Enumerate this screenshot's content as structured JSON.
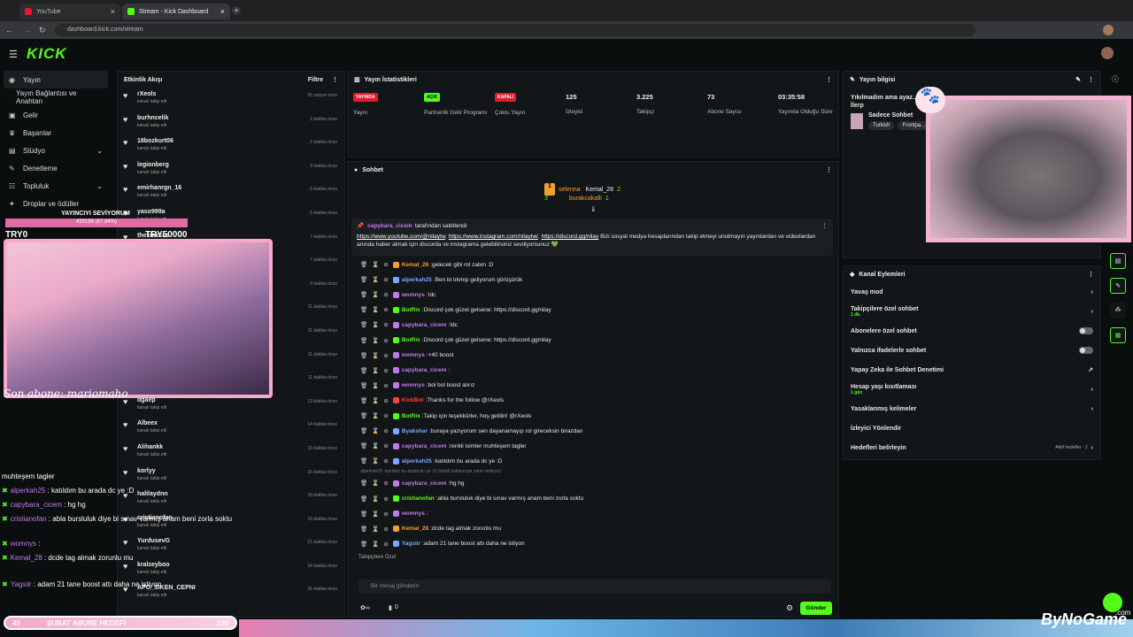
{
  "browser": {
    "tabs": [
      {
        "label": "YouTube"
      },
      {
        "label": "Stream - Kick Dashboard"
      }
    ],
    "url": "dashboard.kick.com/stream"
  },
  "brand": {
    "logo": "KICK",
    "accent": "#53fc18"
  },
  "nav": {
    "items": [
      {
        "label": "Yayın",
        "icon": "broadcast-icon"
      },
      {
        "label": "Yayın Bağlantısı ve Anahtarı",
        "icon": ""
      },
      {
        "label": "Gelir",
        "icon": "wallet-icon"
      },
      {
        "label": "Başarılar",
        "icon": "trophy-icon"
      },
      {
        "label": "Stüdyo",
        "icon": "studio-icon"
      },
      {
        "label": "Denetleme",
        "icon": "wrench-icon"
      },
      {
        "label": "Topluluk",
        "icon": "community-icon"
      },
      {
        "label": "Droplar ve ödüller",
        "icon": "gift-icon"
      }
    ]
  },
  "activity": {
    "title": "Etkinlik Akışı",
    "filter": "Filtre",
    "items": [
      {
        "name": "rXeols",
        "sub": "kanalı takip etti",
        "time": "36 saniye önce"
      },
      {
        "name": "burhncelik",
        "sub": "kanalı takip etti",
        "time": "2 dakika önce"
      },
      {
        "name": "18bozkurt06",
        "sub": "kanalı takip etti",
        "time": "2 dakika önce"
      },
      {
        "name": "legionberg",
        "sub": "kanalı takip etti",
        "time": "3 dakika önce"
      },
      {
        "name": "emirhanrgn_16",
        "sub": "kanalı takip etti",
        "time": "6 dakika önce"
      },
      {
        "name": "yaso999a",
        "sub": "kanalı takip etti",
        "time": "6 dakika önce"
      },
      {
        "name": "thexieksso",
        "sub": "kanalı takip etti",
        "time": "7 dakika önce"
      },
      {
        "name": "",
        "sub": "",
        "time": "7 dakika önce"
      },
      {
        "name": "",
        "sub": "",
        "time": "9 dakika önce"
      },
      {
        "name": "",
        "sub": "",
        "time": "11 dakika önce"
      },
      {
        "name": "",
        "sub": "",
        "time": "11 dakika önce"
      },
      {
        "name": "",
        "sub": "",
        "time": "11 dakika önce"
      },
      {
        "name": "",
        "sub": "",
        "time": "11 dakika önce"
      },
      {
        "name": "dgaep",
        "sub": "kanalı takip etti",
        "time": "13 dakika önce"
      },
      {
        "name": "Albeex",
        "sub": "kanalı takip etti",
        "time": "14 dakika önce"
      },
      {
        "name": "Alihankk",
        "sub": "kanalı takip etti",
        "time": "15 dakika önce"
      },
      {
        "name": "korlyy",
        "sub": "kanalı takip etti",
        "time": "16 dakika önce"
      },
      {
        "name": "halilaydnn",
        "sub": "kanalı takip etti",
        "time": "18 dakika önce"
      },
      {
        "name": "cristianofan",
        "sub": "kanalı takip etti",
        "time": "18 dakika önce"
      },
      {
        "name": "YurdusevG",
        "sub": "kanalı takip etti",
        "time": "21 dakika önce"
      },
      {
        "name": "kralzeyboo",
        "sub": "kanalı takip etti",
        "time": "24 dakika önce"
      },
      {
        "name": "APO_SIKEN_CEPNI",
        "sub": "kanalı takip etti",
        "time": "26 dakika önce"
      }
    ]
  },
  "stats": {
    "title": "Yayın İstatistikleri",
    "cells": [
      {
        "badge": "YAYINDA",
        "label": "Yayın",
        "color": "#e01b2b"
      },
      {
        "badge": "AÇIK",
        "label": "Partnerlik Gelir Programı",
        "color": "#53fc18"
      },
      {
        "badge": "KAPALI",
        "label": "Çoklu Yayın",
        "color": "#e01b2b"
      },
      {
        "value": "125",
        "label": "İzleyici"
      },
      {
        "value": "3.225",
        "label": "Takipçi"
      },
      {
        "value": "73",
        "label": "Abone Sayısı"
      },
      {
        "value": "03:35:58",
        "label": "Yayında Olduğu Süre"
      }
    ]
  },
  "chat": {
    "title": "Sohbet",
    "leaders": [
      {
        "rank": "1",
        "name": "selenna",
        "count": "3"
      },
      {
        "name": "Kemal_28",
        "count": "2"
      },
      {
        "name": "burakcakalli",
        "count": "1"
      }
    ],
    "pinned": {
      "by": "capybara_cicem",
      "by_suffix": "tarafından sabitlendi",
      "link1": "https://www.youtube.com/@nilaytw",
      "link2": "https://www.instagram.com/nilaytw/",
      "link3": "https://discord.gg/nilay",
      "text": "Bizi sosyal medya hesaplarından takip etmeyi unutmayın yayınlardan ve videolardan anında haber almak için discorda ve instagrama gelebilirsiniz seviliyorsunuz 💚"
    },
    "messages": [
      {
        "user": "Kemal_28",
        "color": "#f0a030",
        "text": "gelecek gibi rol zaten :D"
      },
      {
        "user": "alperkah25",
        "color": "#7aa7ff",
        "text": "Ben bi tıkmıp geliyorum görüşürük"
      },
      {
        "user": "womnys",
        "color": "#c07ae8",
        "text": "!dc"
      },
      {
        "user": "BotRix",
        "color": "#53fc18",
        "text": "Discord çok güzel gelsene: https://discord.gg/nilay"
      },
      {
        "user": "capybara_cicem",
        "color": "#c07ae8",
        "text": "!dc"
      },
      {
        "user": "BotRix",
        "color": "#53fc18",
        "text": "Discord çok güzel gelsene: https://discord.gg/nilay"
      },
      {
        "user": "womnys",
        "color": "#c07ae8",
        "text": "+40 boost"
      },
      {
        "user": "capybara_cicem",
        "color": "#c07ae8",
        "text": ""
      },
      {
        "user": "womnys",
        "color": "#c07ae8",
        "text": "bol bol boost alırız"
      },
      {
        "user": "KickBot",
        "color": "#ff4040",
        "text": "Thanks for the follow @rXeols"
      },
      {
        "user": "BotRix",
        "color": "#53fc18",
        "text": "Takip için teşekkürler, hoş geldin! @rXeols"
      },
      {
        "user": "Byakshar",
        "color": "#7aa7ff",
        "text": "buraya yazıyorum sen dayanamayıp rol gireceksin birazdan"
      },
      {
        "user": "capybara_cicem",
        "color": "#c07ae8",
        "text": "renkli isimler muhteşem tagler"
      },
      {
        "user": "alperkah25",
        "color": "#7aa7ff",
        "text": "katıldım bu arada dc ye :D"
      },
      {
        "user": "capybara_cicem",
        "color": "#c07ae8",
        "text": "hg hg"
      },
      {
        "user": "cristianofan",
        "color": "#53fc18",
        "text": "abla bursluluk diye bi sınav varmış anam beni zorla soktu"
      },
      {
        "user": "womnys",
        "color": "#c07ae8",
        "text": ""
      },
      {
        "user": "Kemal_28",
        "color": "#f0a030",
        "text": "dcde tag almak zorunlu mu"
      },
      {
        "user": "Yagsiir",
        "color": "#7aa7ff",
        "text": "adam 21 tane boost attı daha ne istiyon"
      }
    ],
    "reply_hint": "alperkah25: katıldım bu arada dc ye :D  (silindi kullanıcıya yanıt veriliyor)",
    "followers_label": "Takipçilere Özel",
    "placeholder": "Bir mesaj gönderin",
    "send": "Gönder",
    "count": "0"
  },
  "streaminfo": {
    "title": "Yayın bilgisi",
    "stream_title": "Yıkılmadım ama ayaz...",
    "stream_title2": "İlerp",
    "channel": "Sadece Sohbet",
    "tags": [
      "Turkish",
      "Frontpa..."
    ]
  },
  "channel_actions": {
    "title": "Kanal Eylemleri",
    "items": [
      {
        "label": "Yavaş mod",
        "type": "chevron",
        "sub": ""
      },
      {
        "label": "Takipçilere özel sohbet",
        "type": "chevron",
        "sub": "1 dk."
      },
      {
        "label": "Abonelere özel sohbet",
        "type": "toggle",
        "sub": ""
      },
      {
        "label": "Yalnızca ifadelerle sohbet",
        "type": "toggle",
        "sub": ""
      },
      {
        "label": "Yapay Zeka ile Sohbet Denetimi",
        "type": "link",
        "sub": ""
      },
      {
        "label": "Hesap yaşı kısıtlaması",
        "type": "chevron",
        "sub": "1 gün"
      },
      {
        "label": "Yasaklanmış kelimeler",
        "type": "chevron",
        "sub": ""
      },
      {
        "label": "İzleyici Yönlendir",
        "type": "none",
        "sub": ""
      },
      {
        "label": "Hedefleri belirleyin",
        "type": "chevron",
        "sub": "",
        "extra": "Aktif hedefler - 2"
      }
    ]
  },
  "overlay": {
    "supporter": "YAYINCIYI SEVİYORUM",
    "supporter_amount": "439196 (87.84%)",
    "try_left": "TRY0",
    "try_right": "TRY50000",
    "last_sub": "Son abone: mariomaho",
    "chat": [
      {
        "user": "",
        "text": "muhteşem tagler"
      },
      {
        "user": "alperkah25",
        "text": " : katıldım bu arada dc ye :D"
      },
      {
        "user": "capybara_cicem",
        "text": " : hg hg"
      },
      {
        "user": "cristianofan",
        "text": " : abla bursluluk diye bi sınav varmış anam beni zorla soktu"
      },
      {
        "user": "womnys",
        "text": " :"
      },
      {
        "user": "Kemal_28",
        "text": " : dcde tag almak zorunlu mu"
      },
      {
        "user": "Yagsiir",
        "text": " : adam 21 tane boost attı daha ne istiyon"
      }
    ],
    "goal_current": "45",
    "goal_label": "ŞUBAT ABUNE HEDEFİ",
    "goal_target": "100",
    "watermark": "ByNoGame",
    "watermark_sub": ".com"
  }
}
